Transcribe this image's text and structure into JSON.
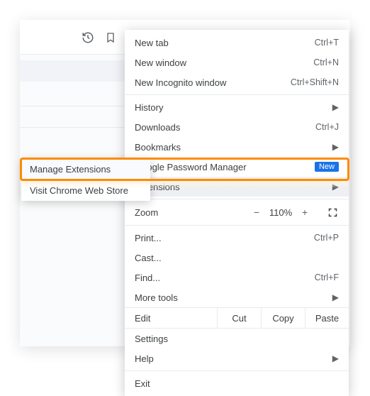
{
  "submenu": {
    "items": [
      {
        "label": "Manage Extensions"
      },
      {
        "label": "Visit Chrome Web Store"
      }
    ]
  },
  "menu": {
    "newtab": {
      "label": "New tab",
      "shortcut": "Ctrl+T"
    },
    "newwin": {
      "label": "New window",
      "shortcut": "Ctrl+N"
    },
    "incog": {
      "label": "New Incognito window",
      "shortcut": "Ctrl+Shift+N"
    },
    "history": {
      "label": "History"
    },
    "downloads": {
      "label": "Downloads",
      "shortcut": "Ctrl+J"
    },
    "bookmarks": {
      "label": "Bookmarks"
    },
    "pwmgr": {
      "label": "Google Password Manager",
      "badge": "New"
    },
    "extensions": {
      "label": "Extensions"
    },
    "zoom": {
      "label": "Zoom",
      "minus": "−",
      "value": "110%",
      "plus": "+"
    },
    "print": {
      "label": "Print...",
      "shortcut": "Ctrl+P"
    },
    "cast": {
      "label": "Cast..."
    },
    "find": {
      "label": "Find...",
      "shortcut": "Ctrl+F"
    },
    "moretools": {
      "label": "More tools"
    },
    "edit": {
      "label": "Edit",
      "cut": "Cut",
      "copy": "Copy",
      "paste": "Paste"
    },
    "settings": {
      "label": "Settings"
    },
    "help": {
      "label": "Help"
    },
    "exit": {
      "label": "Exit"
    }
  }
}
